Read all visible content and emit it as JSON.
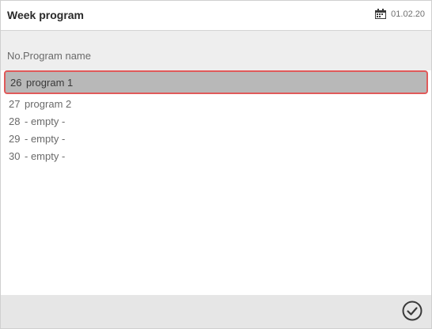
{
  "app": {
    "title": "Week program",
    "date": "01.02.20"
  },
  "table": {
    "headers": {
      "no": "No.",
      "name": "Program name"
    },
    "rows": [
      {
        "no": "26",
        "name": "program 1",
        "selected": true
      },
      {
        "no": "27",
        "name": "program 2",
        "selected": false
      },
      {
        "no": "28",
        "name": "- empty -",
        "selected": false
      },
      {
        "no": "29",
        "name": "- empty -",
        "selected": false
      },
      {
        "no": "30",
        "name": "- empty -",
        "selected": false
      }
    ]
  },
  "icons": {
    "calendar": "calendar-icon",
    "confirm": "checkmark-circle-icon"
  },
  "colors": {
    "selection_border": "#e05a5a",
    "selection_fill": "#b8b8b8",
    "header_bg": "#eeeeee",
    "footer_bg": "#e6e6e6"
  }
}
